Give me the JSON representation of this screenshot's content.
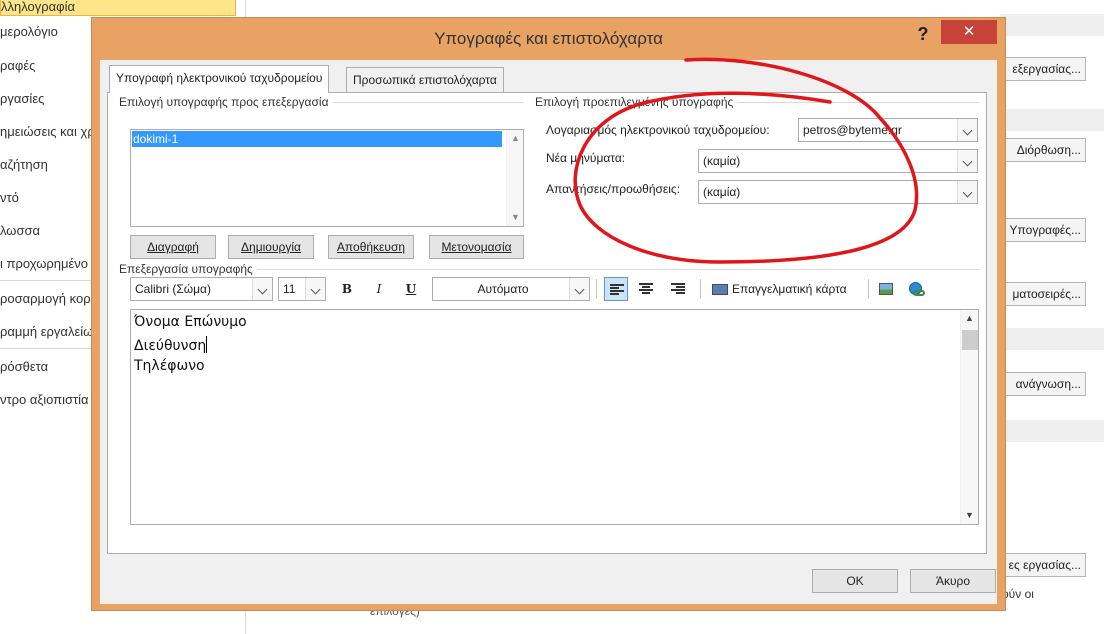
{
  "background": {
    "nav_items": [
      "λληλογραφία",
      "μερολόγιο",
      "ραφές",
      "ργασίες",
      "ημειώσεις και χρ",
      "αζήτηση",
      "λωσσα",
      "ι προχωρημένο",
      "ροσαρμογή κορ",
      "ραμμή εργαλείων",
      "ρόσθετα",
      "ντρο αξιοπιστία"
    ],
    "nav_item_partial": "ντό",
    "right_buttons": [
      "εξεργασίας...",
      "Διόρθωση...",
      "Υπογραφές...",
      "ματοσειρές...",
      "ανάγνωση...",
      "ες εργασίας..."
    ],
    "right_text": "ούν οι",
    "bottom_text": "επιλογές)"
  },
  "dialog": {
    "title": "Υπογραφές και επιστολόχαρτα",
    "help_label": "?",
    "close_label": "✕",
    "tabs": [
      {
        "label": "Υπογραφή ηλεκτρονικού ταχυδρομείου",
        "active": true
      },
      {
        "label": "Προσωπικά επιστολόχαρτα",
        "active": false
      }
    ],
    "select_sig": {
      "label": "Επιλογή υπογραφής προς επεξεργασία",
      "items": [
        "dokimi-1"
      ],
      "buttons": {
        "delete": "Διαγραφή",
        "new": "Δημιουργία",
        "save": "Αποθήκευση",
        "rename": "Μετονομασία"
      }
    },
    "default_sig": {
      "label": "Επιλογή προεπιλεγμένης υπογραφής",
      "account_label": "Λογαριασμός ηλεκτρονικού ταχυδρομείου:",
      "account_value": "petros@byteme.gr",
      "new_messages_label": "Νέα μηνύματα:",
      "new_messages_value": "(καμία)",
      "replies_label": "Απαντήσεις/προωθήσεις:",
      "replies_value": "(καμία)"
    },
    "edit_sig": {
      "label": "Επεξεργασία υπογραφής",
      "font": "Calibri (Σώμα)",
      "size": "11",
      "bold": "B",
      "italic": "I",
      "underline": "U",
      "color": "Αυτόματο",
      "business_card": "Επαγγελματική κάρτα",
      "lines": [
        "Όνομα Επώνυμο",
        "Διεύθυνση",
        "Τηλέφωνο"
      ]
    },
    "ok": "OK",
    "cancel": "Άκυρο"
  },
  "colors": {
    "dialog_frame": "#e8a364",
    "close_button": "#c7433a",
    "selection": "#3399ff",
    "annotation": "#e0161b"
  }
}
